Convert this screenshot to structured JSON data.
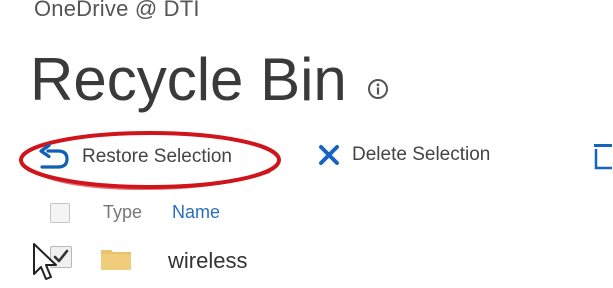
{
  "breadcrumb": "OneDrive @ DTI",
  "page": {
    "title": "Recycle Bin",
    "info_icon": "info-icon"
  },
  "toolbar": {
    "restore_label": "Restore Selection",
    "restore_icon": "undo-arrow-icon",
    "delete_label": "Delete Selection",
    "delete_icon": "x-icon",
    "empty_icon": "trash-icon",
    "highlight_color": "#d0141c"
  },
  "list": {
    "columns": {
      "type": "Type",
      "name": "Name"
    },
    "rows": [
      {
        "checked": true,
        "type_icon": "folder-icon",
        "name": "wireless"
      }
    ]
  },
  "colors": {
    "accent": "#0f5fb5",
    "delete_x": "#1565c0",
    "link": "#2a6ebd",
    "folder": "#e8c36a"
  }
}
